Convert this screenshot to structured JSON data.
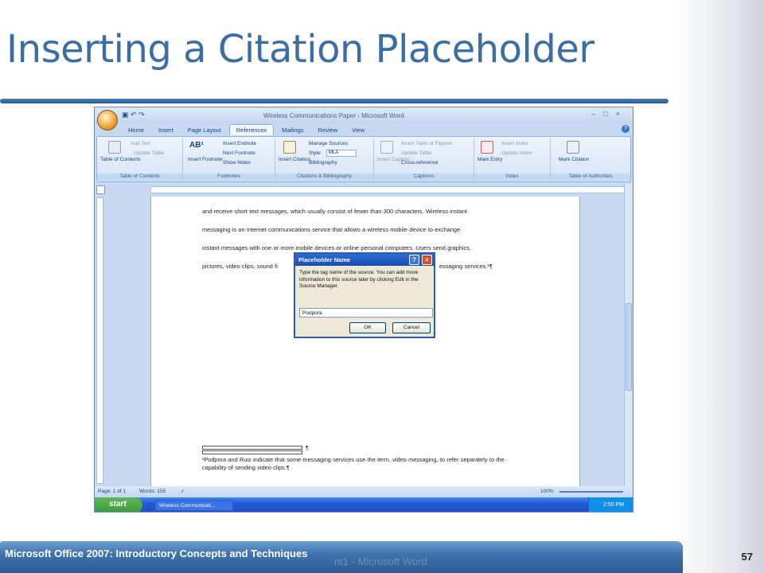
{
  "slide": {
    "title": "Inserting a Citation Placeholder",
    "footer": "Microsoft Office 2007: Introductory Concepts and Techniques",
    "page_number": "57",
    "footer_ghost": "nt1 - Microsoft Word"
  },
  "window": {
    "title": "Wireless Communications Paper - Microsoft Word",
    "tabs": [
      "Home",
      "Insert",
      "Page Layout",
      "References",
      "Mailings",
      "Review",
      "View"
    ],
    "active_tab": "References"
  },
  "ribbon": {
    "toc": {
      "label": "Table of Contents",
      "button": "Table of Contents",
      "add_text": "Add Text",
      "update_table": "Update Table"
    },
    "footnotes": {
      "label": "Footnotes",
      "insert_footnote": "Insert Footnote",
      "insert_endnote": "Insert Endnote",
      "next_footnote": "Next Footnote",
      "show_notes": "Show Notes"
    },
    "citations": {
      "label": "Citations & Bibliography",
      "insert_citation": "Insert Citation",
      "manage_sources": "Manage Sources",
      "style_label": "Style:",
      "style_value": "MLA",
      "bibliography": "Bibliography"
    },
    "captions": {
      "label": "Captions",
      "insert_caption": "Insert Caption",
      "insert_table_of_figures": "Insert Table of Figures",
      "update_table": "Update Table",
      "cross_reference": "Cross-reference"
    },
    "index": {
      "label": "Index",
      "mark_entry": "Mark Entry",
      "insert_index": "Insert Index",
      "update_index": "Update Index"
    },
    "toa": {
      "label": "Table of Authorities",
      "mark_citation": "Mark Citation"
    }
  },
  "document": {
    "lines": [
      "and·receive·short·text·messages,·which·usually·consist·of·fewer·than·300·characters.·Wireless·instant·",
      "messaging·is·an·Internet·communications·service·that·allows·a·wireless·mobile·device·to·exchange·",
      "instant·messages·with·one·or·more·mobile·devices·or·online·personal·computers.·Users·send·graphics,·",
      "pictures,·video·clips,·sound·fi",
      "essaging·services.¹¶"
    ],
    "footnote_mark": "¶",
    "footnote_lines": [
      "¹Podpora·and·Ruiz·indicate·that·some·messaging·services·use·the·term,·video·messaging,·to·refer·separately·to·the·",
      "capability·of·sending·video·clips.¶"
    ]
  },
  "dialog": {
    "title": "Placeholder Name",
    "message": "Type the tag name of the source. You can add more information to this source later by clicking Edit in the Source Manager.",
    "input_value": "Podpora",
    "ok": "OK",
    "cancel": "Cancel"
  },
  "status": {
    "page": "Page: 1 of 1",
    "words": "Words: 155",
    "zoom": "100%"
  },
  "taskbar": {
    "start": "start",
    "task": "Wireless Communicati...",
    "clock": "2:50 PM"
  }
}
